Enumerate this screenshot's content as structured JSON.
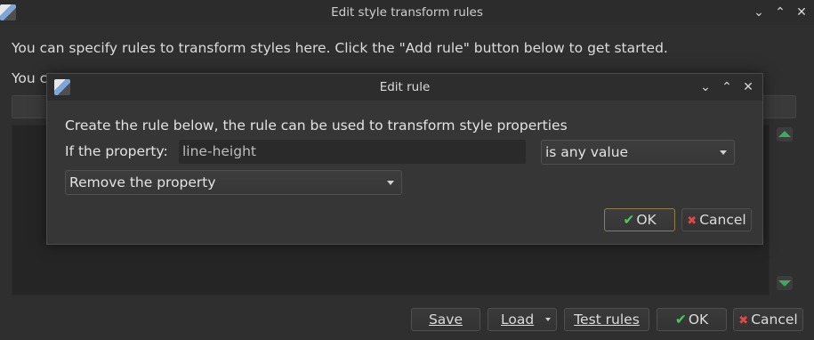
{
  "main_window": {
    "title": "Edit style transform rules",
    "intro_text": "You can specify rules to transform styles here. Click the \"Add rule\" button below to get started.",
    "intro_text_partial": "You c",
    "buttons": {
      "save": "Save",
      "load": "Load",
      "test_rules": "Test rules",
      "ok": "OK",
      "cancel": "Cancel"
    }
  },
  "dialog": {
    "title": "Edit rule",
    "description": "Create the rule below, the rule can be used to transform style properties",
    "property_label": "If the property:",
    "property_value": "line-height",
    "match_select": "is any value",
    "action_select": "Remove the property",
    "ok_label": "OK",
    "cancel_label": "Cancel"
  },
  "icons": {
    "app": "app-icon",
    "minimize": "chevron-down-icon",
    "maximize": "chevron-up-icon",
    "close": "close-icon",
    "ok": "checkmark-icon",
    "cancel": "x-icon",
    "move_up": "arrow-up-icon",
    "move_down": "arrow-down-icon"
  },
  "colors": {
    "background": "#2f2f2f",
    "accent_green": "#3cab62",
    "cancel_red": "#e04848",
    "default_button_border": "#8c7f4e"
  }
}
